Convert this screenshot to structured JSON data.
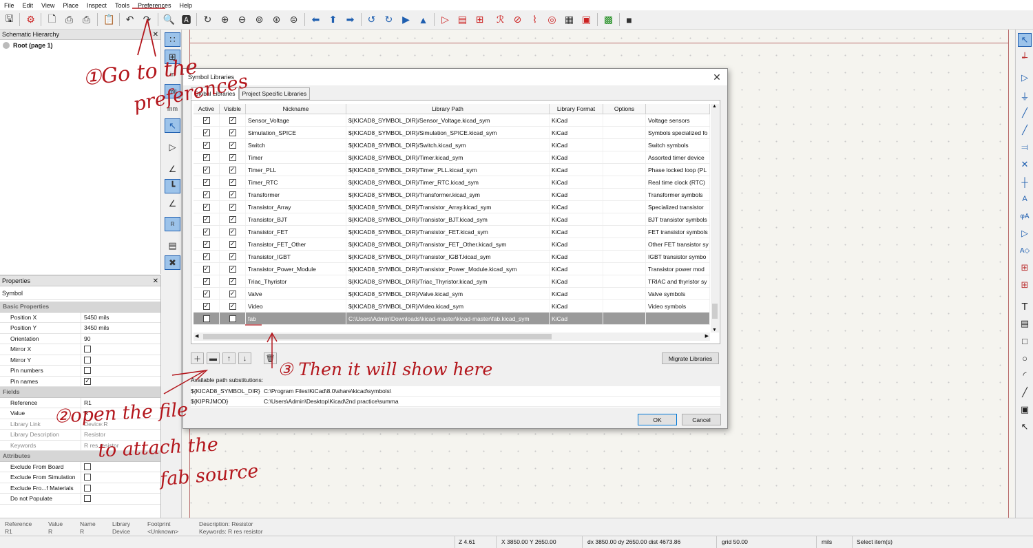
{
  "menu": [
    "File",
    "Edit",
    "View",
    "Place",
    "Inspect",
    "Tools",
    "Preferences",
    "Help"
  ],
  "hierarchy": {
    "title": "Schematic Hierarchy",
    "root": "Root (page 1)"
  },
  "properties": {
    "title": "Properties",
    "type": "Symbol",
    "sections": [
      {
        "name": "Basic Properties",
        "rows": [
          {
            "k": "Position X",
            "v": "5450 mils"
          },
          {
            "k": "Position Y",
            "v": "3450 mils"
          },
          {
            "k": "Orientation",
            "v": "90"
          },
          {
            "k": "Mirror X",
            "cb": false
          },
          {
            "k": "Mirror Y",
            "cb": false
          },
          {
            "k": "Pin numbers",
            "cb": false
          },
          {
            "k": "Pin names",
            "cb": true
          }
        ]
      },
      {
        "name": "Fields",
        "rows": [
          {
            "k": "Reference",
            "v": "R1"
          },
          {
            "k": "Value",
            "v": "R"
          },
          {
            "k": "Library Link",
            "v": "Device:R",
            "grey": true
          },
          {
            "k": "Library Description",
            "v": "Resistor",
            "grey": true
          },
          {
            "k": "Keywords",
            "v": "R res resistor",
            "grey": true
          }
        ]
      },
      {
        "name": "Attributes",
        "rows": [
          {
            "k": "Exclude From Board",
            "cb": false
          },
          {
            "k": "Exclude From Simulation",
            "cb": false
          },
          {
            "k": "Exclude Fro...f Materials",
            "cb": false
          },
          {
            "k": "Do not Populate",
            "cb": false
          }
        ]
      }
    ]
  },
  "dialog": {
    "title": "Symbol Libraries",
    "tabs": [
      "Global Libraries",
      "Project Specific Libraries"
    ],
    "columns": [
      "Active",
      "Visible",
      "Nickname",
      "Library Path",
      "Library Format",
      "Options",
      ""
    ],
    "rows": [
      [
        "Sensor_Voltage",
        "${KICAD8_SYMBOL_DIR}/Sensor_Voltage.kicad_sym",
        "KiCad",
        "Voltage sensors"
      ],
      [
        "Simulation_SPICE",
        "${KICAD8_SYMBOL_DIR}/Simulation_SPICE.kicad_sym",
        "KiCad",
        "Symbols specialized fo"
      ],
      [
        "Switch",
        "${KICAD8_SYMBOL_DIR}/Switch.kicad_sym",
        "KiCad",
        "Switch symbols"
      ],
      [
        "Timer",
        "${KICAD8_SYMBOL_DIR}/Timer.kicad_sym",
        "KiCad",
        "Assorted timer device"
      ],
      [
        "Timer_PLL",
        "${KICAD8_SYMBOL_DIR}/Timer_PLL.kicad_sym",
        "KiCad",
        "Phase locked loop (PL"
      ],
      [
        "Timer_RTC",
        "${KICAD8_SYMBOL_DIR}/Timer_RTC.kicad_sym",
        "KiCad",
        "Real time clock (RTC)"
      ],
      [
        "Transformer",
        "${KICAD8_SYMBOL_DIR}/Transformer.kicad_sym",
        "KiCad",
        "Transformer symbols"
      ],
      [
        "Transistor_Array",
        "${KICAD8_SYMBOL_DIR}/Transistor_Array.kicad_sym",
        "KiCad",
        "Specialized transistor"
      ],
      [
        "Transistor_BJT",
        "${KICAD8_SYMBOL_DIR}/Transistor_BJT.kicad_sym",
        "KiCad",
        "BJT transistor symbols"
      ],
      [
        "Transistor_FET",
        "${KICAD8_SYMBOL_DIR}/Transistor_FET.kicad_sym",
        "KiCad",
        "FET transistor symbols"
      ],
      [
        "Transistor_FET_Other",
        "${KICAD8_SYMBOL_DIR}/Transistor_FET_Other.kicad_sym",
        "KiCad",
        "Other FET transistor sy"
      ],
      [
        "Transistor_IGBT",
        "${KICAD8_SYMBOL_DIR}/Transistor_IGBT.kicad_sym",
        "KiCad",
        "IGBT transistor symbo"
      ],
      [
        "Transistor_Power_Module",
        "${KICAD8_SYMBOL_DIR}/Transistor_Power_Module.kicad_sym",
        "KiCad",
        "Transistor power mod"
      ],
      [
        "Triac_Thyristor",
        "${KICAD8_SYMBOL_DIR}/Triac_Thyristor.kicad_sym",
        "KiCad",
        "TRIAC and thyristor sy"
      ],
      [
        "Valve",
        "${KICAD8_SYMBOL_DIR}/Valve.kicad_sym",
        "KiCad",
        "Valve symbols"
      ],
      [
        "Video",
        "${KICAD8_SYMBOL_DIR}/Video.kicad_sym",
        "KiCad",
        "Video symbols"
      ],
      [
        "fab",
        "C:\\Users\\Admin\\Downloads\\kicad-master\\kicad-master\\fab.kicad_sym",
        "KiCad",
        ""
      ]
    ],
    "migrate": "Migrate Libraries",
    "subst_label": "Available path substitutions:",
    "substitutions": [
      {
        "k": "${KICAD8_SYMBOL_DIR}",
        "v": "C:\\Program Files\\KiCad\\8.0\\share\\kicad\\symbols\\"
      },
      {
        "k": "${KIPRJMOD}",
        "v": "C:\\Users\\Admin\\Desktop\\Kicad\\2nd practice\\summa"
      }
    ],
    "ok": "OK",
    "cancel": "Cancel"
  },
  "msg_panel": [
    {
      "h": "Reference",
      "v": "R1"
    },
    {
      "h": "Value",
      "v": "R"
    },
    {
      "h": "Name",
      "v": "R"
    },
    {
      "h": "Library",
      "v": "Device"
    },
    {
      "h": "Footprint",
      "v": "<Unknown>"
    },
    {
      "h": "Description: Resistor",
      "v": "Keywords: R res resistor"
    }
  ],
  "status": {
    "zoom": "Z 4.61",
    "xy": "X 3850.00  Y 2650.00",
    "delta": "dx 3850.00  dy 2650.00  dist 4673.86",
    "grid": "grid 50.00",
    "units": "mils",
    "mode": "Select item(s)"
  },
  "annotations": {
    "step1a": "①Go to the",
    "step1b": "preferences",
    "step2a": "②open the file",
    "step2b": "to attach the",
    "step2c": "fab source",
    "step3": "③ Then it will show here"
  },
  "colors": {
    "accent": "#1f5fb0",
    "annotation": "#b3161c",
    "selected_row": "#9a9a9a"
  }
}
